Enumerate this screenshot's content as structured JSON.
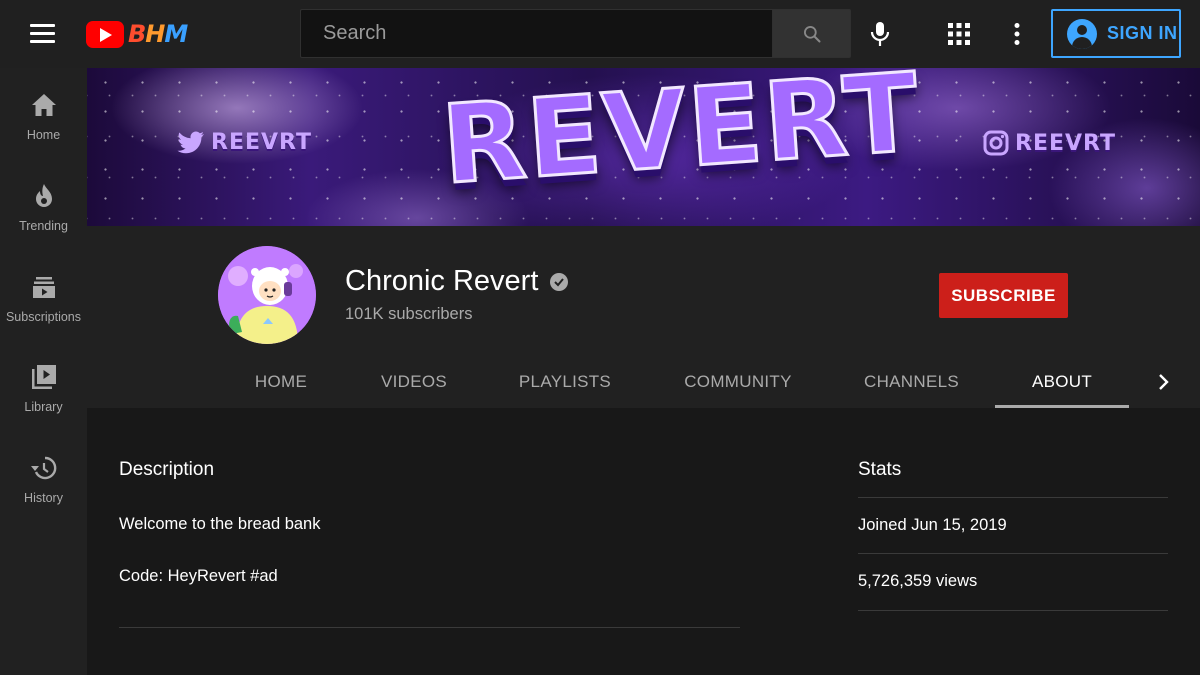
{
  "header": {
    "logo_text": "BHM",
    "search_placeholder": "Search",
    "signin_label": "SIGN IN"
  },
  "sidebar": {
    "items": [
      {
        "label": "Home",
        "icon": "home-icon"
      },
      {
        "label": "Trending",
        "icon": "flame-icon"
      },
      {
        "label": "Subscriptions",
        "icon": "subscriptions-icon"
      },
      {
        "label": "Library",
        "icon": "library-icon"
      },
      {
        "label": "History",
        "icon": "history-icon"
      }
    ]
  },
  "banner": {
    "title": "REVERT",
    "twitter_handle": "REEVRT",
    "instagram_handle": "REEVRT"
  },
  "channel": {
    "name": "Chronic Revert",
    "subscribers": "101K subscribers",
    "subscribe_label": "SUBSCRIBE"
  },
  "tabs": [
    {
      "label": "HOME",
      "active": false
    },
    {
      "label": "VIDEOS",
      "active": false
    },
    {
      "label": "PLAYLISTS",
      "active": false
    },
    {
      "label": "COMMUNITY",
      "active": false
    },
    {
      "label": "CHANNELS",
      "active": false
    },
    {
      "label": "ABOUT",
      "active": true
    }
  ],
  "about": {
    "description_title": "Description",
    "description_lines": [
      "Welcome to the bread bank",
      "Code: HeyRevert #ad"
    ],
    "stats_title": "Stats",
    "joined": "Joined Jun 15, 2019",
    "views": "5,726,359 views"
  },
  "colors": {
    "subscribe_red": "#cc1f1a",
    "signin_blue": "#3ea6ff",
    "background": "#181818",
    "header_bg": "#212121"
  }
}
